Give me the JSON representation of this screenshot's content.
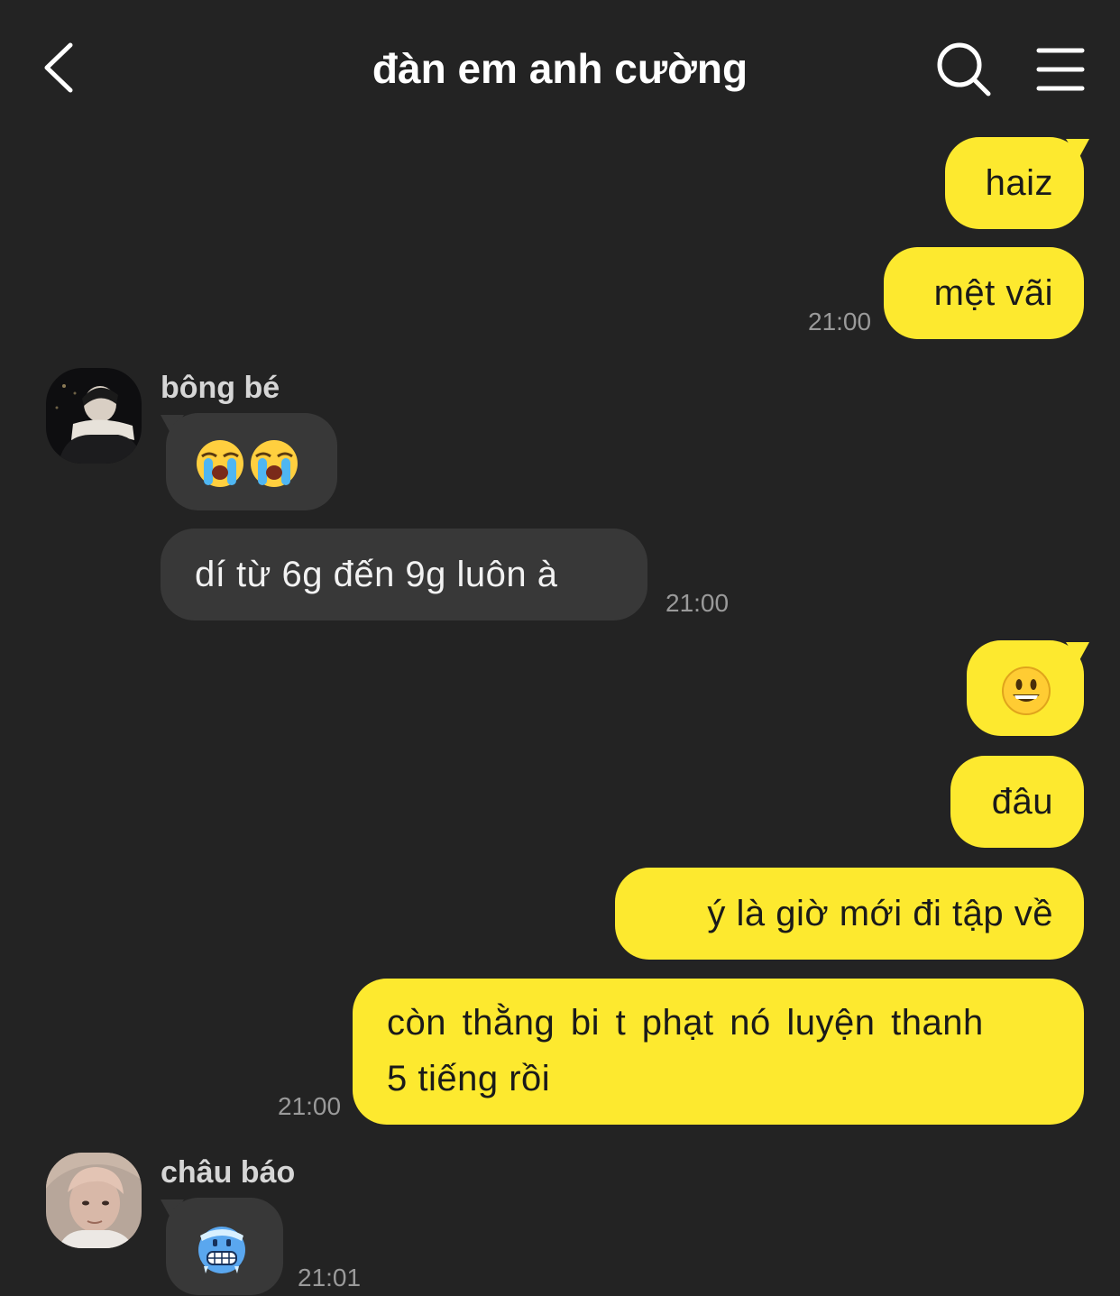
{
  "header": {
    "title": "đàn em anh cường",
    "back_icon": "chevron-left-icon",
    "search_icon": "search-icon",
    "menu_icon": "hamburger-menu-icon"
  },
  "colors": {
    "background": "#232323",
    "my_bubble": "#fde92f",
    "their_bubble": "#383838",
    "timestamp": "#9a9a9a"
  },
  "messages": [
    {
      "from": "me",
      "text": "haiz"
    },
    {
      "from": "me",
      "text": "mệt vãi",
      "time": "21:00"
    },
    {
      "from": "bông bé",
      "sender_label": "bông bé",
      "emoji": "loudly-crying-face x2"
    },
    {
      "from": "bông bé",
      "text": "dí từ 6g đến 9g luôn à",
      "time": "21:00"
    },
    {
      "from": "me",
      "emoji": "grinning-face"
    },
    {
      "from": "me",
      "text": "đâu"
    },
    {
      "from": "me",
      "text": "ý là giờ mới đi tập về"
    },
    {
      "from": "me",
      "text_line1": "còn thằng bi t phạt nó luyện thanh",
      "text_line2": "5 tiếng rồi",
      "time": "21:00"
    },
    {
      "from": "châu báo",
      "sender_label": "châu báo",
      "emoji": "cold-face",
      "time": "21:01"
    }
  ]
}
